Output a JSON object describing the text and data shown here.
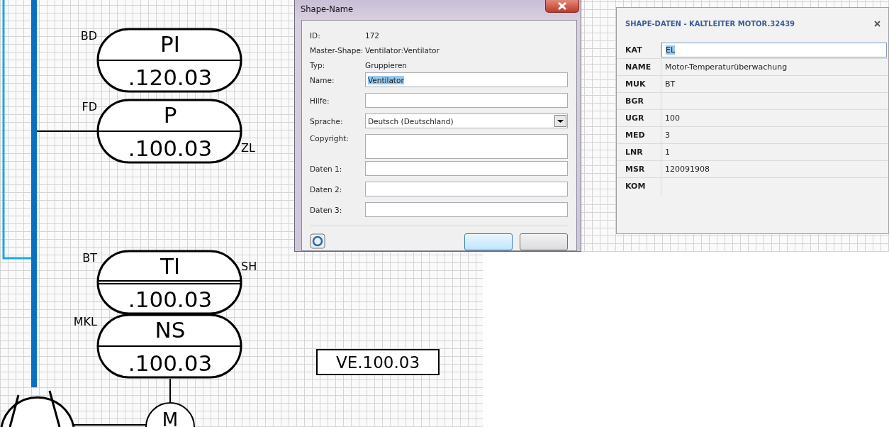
{
  "diagram": {
    "instruments": [
      {
        "top": "PI",
        "bottom": ".120.03",
        "left_label": "BD",
        "double_divider": false
      },
      {
        "top": "P",
        "bottom": ".100.03",
        "left_label": "FD",
        "right_label": "ZL",
        "double_divider": false
      },
      {
        "top": "TI",
        "bottom": ".100.03",
        "left_label": "BT",
        "right_label": "SH",
        "double_divider": true
      },
      {
        "top": "NS",
        "bottom": ".100.03",
        "left_label": "MKL",
        "double_divider": false
      }
    ],
    "tag_box": "VE.100.03",
    "motor_label": "M"
  },
  "dialog": {
    "title": "Shape-Name",
    "info": [
      {
        "label": "ID:",
        "value": "172"
      },
      {
        "label": "Master-Shape:",
        "value": "Ventilator:Ventilator"
      },
      {
        "label": "Typ:",
        "value": "Gruppieren"
      }
    ],
    "fields": [
      {
        "label": "Name:",
        "kind": "text",
        "value": "Ventilator",
        "text_selected": true
      },
      {
        "label": "Hilfe:",
        "kind": "text"
      },
      {
        "label": "Sprache:",
        "kind": "select",
        "value": "Deutsch (Deutschland)"
      },
      {
        "label": "Copyright:",
        "kind": "multiline"
      },
      {
        "label": "Daten 1:",
        "kind": "text"
      },
      {
        "label": "Daten 2:",
        "kind": "text"
      },
      {
        "label": "Daten 3:",
        "kind": "text"
      }
    ]
  },
  "panel": {
    "title": "SHAPE-DATEN - KALTLEITER MOTOR.32439",
    "rows": [
      {
        "key": "KAT",
        "value": "EL",
        "editing": true
      },
      {
        "key": "NAME",
        "value": "Motor-Temperaturüberwachung"
      },
      {
        "key": "MUK",
        "value": "BT"
      },
      {
        "key": "BGR"
      },
      {
        "key": "UGR",
        "value": "100"
      },
      {
        "key": "MED",
        "value": "3"
      },
      {
        "key": "LNR",
        "value": "1"
      },
      {
        "key": "MSR",
        "value": "120091908"
      },
      {
        "key": "KOM"
      }
    ]
  }
}
